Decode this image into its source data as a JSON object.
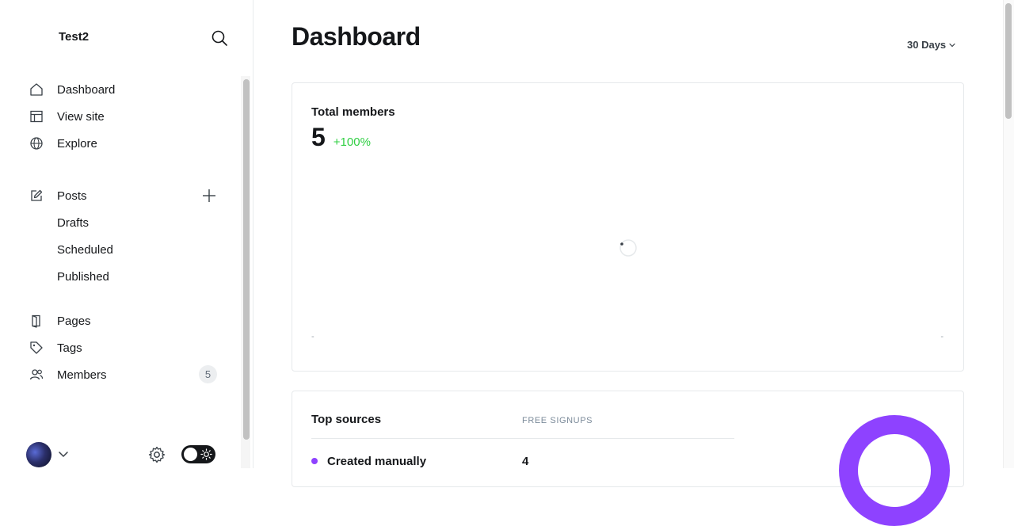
{
  "sidebar": {
    "site_title": "Test2",
    "nav": [
      {
        "label": "Dashboard",
        "icon": "home-icon"
      },
      {
        "label": "View site",
        "icon": "layout-icon"
      },
      {
        "label": "Explore",
        "icon": "globe-icon"
      }
    ],
    "posts": {
      "label": "Posts",
      "icon": "edit-icon",
      "children": [
        {
          "label": "Drafts"
        },
        {
          "label": "Scheduled"
        },
        {
          "label": "Published"
        }
      ]
    },
    "secondary": [
      {
        "label": "Pages",
        "icon": "pages-icon"
      },
      {
        "label": "Tags",
        "icon": "tag-icon"
      },
      {
        "label": "Members",
        "icon": "users-icon",
        "badge": "5"
      }
    ]
  },
  "header": {
    "title": "Dashboard",
    "range": "30 Days"
  },
  "members_card": {
    "title": "Total members",
    "value": "5",
    "delta": "+100%",
    "axis_start": "-",
    "axis_end": "-",
    "delta_color": "#30cf43"
  },
  "sources_card": {
    "title": "Top sources",
    "column": "FREE SIGNUPS",
    "rows": [
      {
        "name": "Created manually",
        "count": "4"
      }
    ],
    "accent": "#8e42ff"
  }
}
